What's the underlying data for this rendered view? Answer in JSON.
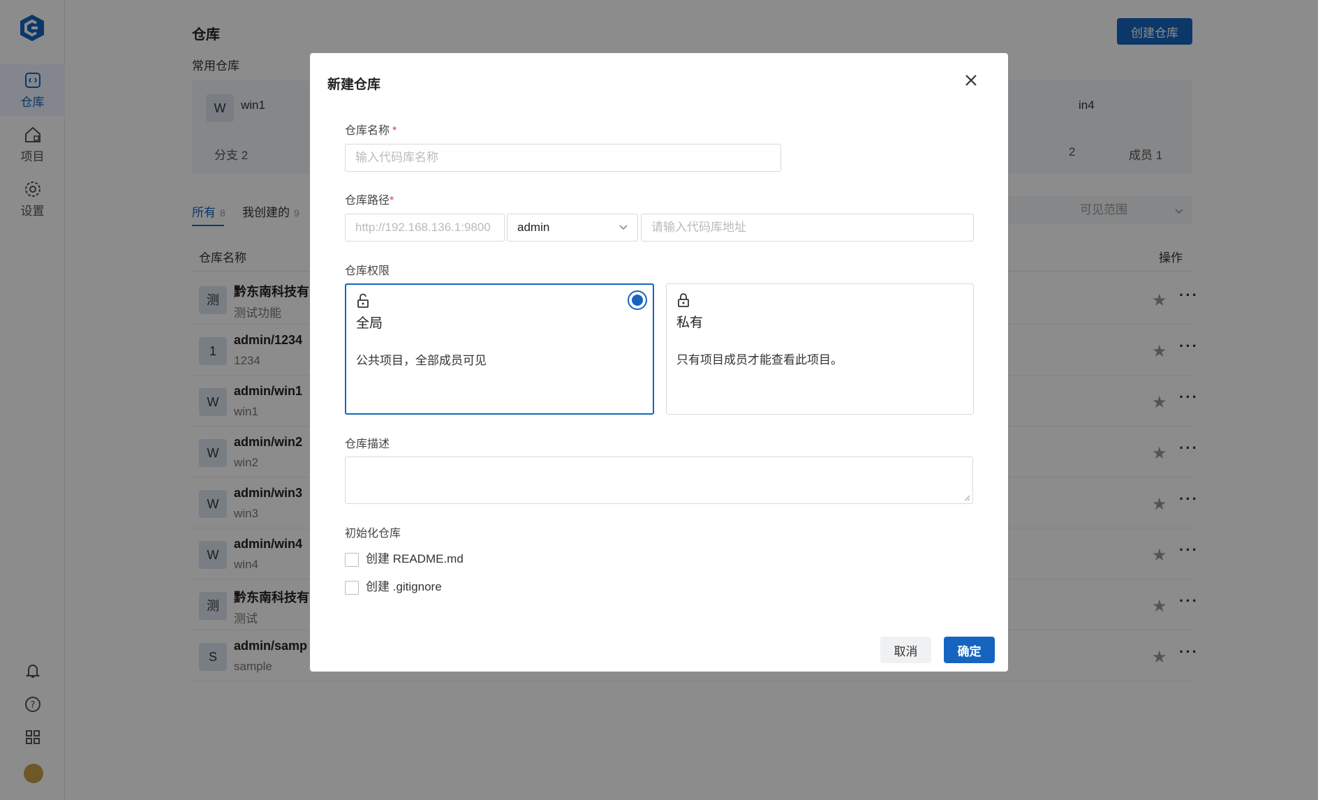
{
  "sidebar": {
    "items": [
      {
        "label": "仓库",
        "icon": "repo-icon"
      },
      {
        "label": "项目",
        "icon": "project-icon"
      },
      {
        "label": "设置",
        "icon": "settings-icon"
      }
    ],
    "bottom_icons": [
      "bell-icon",
      "help-icon",
      "apps-icon",
      "avatar"
    ]
  },
  "header": {
    "title": "仓库",
    "create_label": "创建仓库"
  },
  "favorites": {
    "title": "常用仓库",
    "cards": [
      {
        "avatar": "W",
        "name": "win1",
        "branch_label": "分支 2"
      },
      {
        "name": "in4",
        "branch_suffix": "2",
        "member_label": "成员 1"
      }
    ]
  },
  "tabs": [
    {
      "label": "所有",
      "count": "8"
    },
    {
      "label": "我创建的",
      "count": "9"
    }
  ],
  "filter": {
    "placeholder": "可见范围"
  },
  "table": {
    "headers": {
      "name": "仓库名称",
      "actions": "操作"
    },
    "rows": [
      {
        "avatar": "测",
        "name": "黔东南科技有",
        "desc": "测试功能"
      },
      {
        "avatar": "1",
        "name": "admin/1234",
        "desc": "1234"
      },
      {
        "avatar": "W",
        "name": "admin/win1",
        "desc": "win1"
      },
      {
        "avatar": "W",
        "name": "admin/win2",
        "desc": "win2"
      },
      {
        "avatar": "W",
        "name": "admin/win3",
        "desc": "win3"
      },
      {
        "avatar": "W",
        "name": "admin/win4",
        "desc": "win4"
      },
      {
        "avatar": "测",
        "name": "黔东南科技有",
        "desc": "测试"
      },
      {
        "avatar": "S",
        "name": "admin/samp",
        "desc": "sample"
      }
    ]
  },
  "modal": {
    "title": "新建仓库",
    "name_label": "仓库名称",
    "name_placeholder": "输入代码库名称",
    "path_label": "仓库路径",
    "path_prefix": "http://192.168.136.1:9800",
    "path_owner": "admin",
    "path_placeholder": "请输入代码库地址",
    "perm_label": "仓库权限",
    "perm_options": [
      {
        "title": "全局",
        "desc": "公共项目，全部成员可见",
        "selected": true
      },
      {
        "title": "私有",
        "desc": "只有项目成员才能查看此项目。",
        "selected": false
      }
    ],
    "desc_label": "仓库描述",
    "init_label": "初始化仓库",
    "init_options": [
      "创建 README.md",
      "创建 .gitignore"
    ],
    "cancel_label": "取消",
    "ok_label": "确定"
  },
  "colors": {
    "primary": "#1565c0",
    "required": "#e53935"
  }
}
